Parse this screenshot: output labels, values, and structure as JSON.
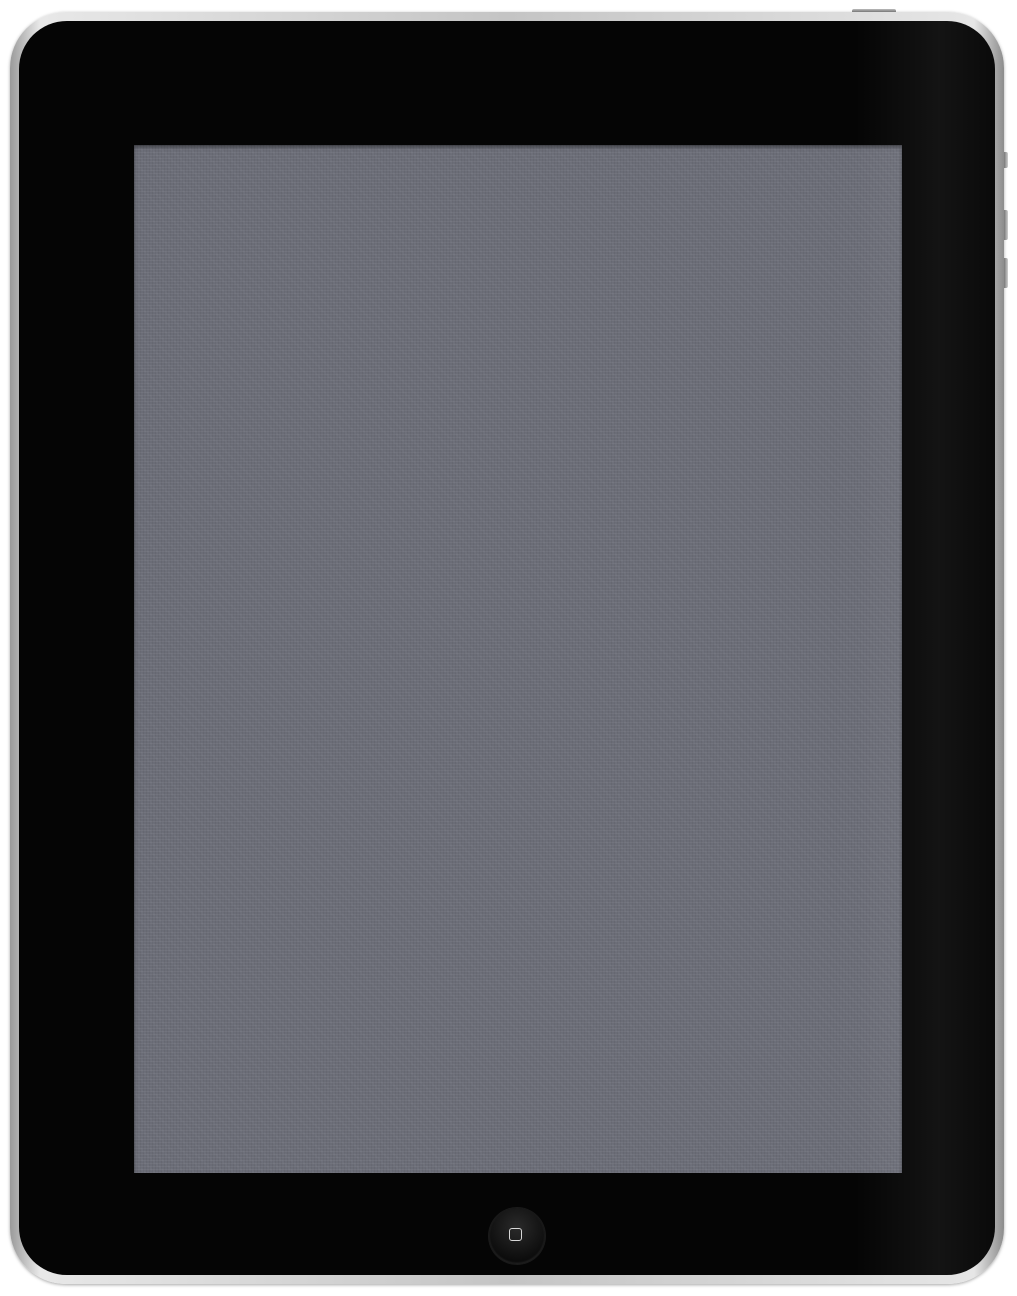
{
  "device": {
    "model": "iPad",
    "bezel_color": "#050505",
    "frame_color": "#c4c4c4"
  },
  "screen": {
    "wallpaper": "gray-linen-texture",
    "wallpaper_color": "#6b6d77",
    "content": ""
  },
  "icons": {
    "home_button": "home-button-square-icon"
  }
}
